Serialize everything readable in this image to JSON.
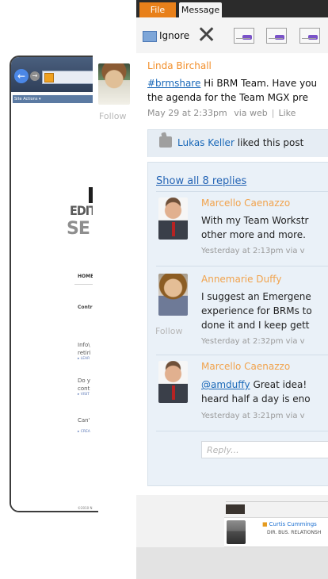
{
  "background_app": {
    "tabs": [
      "File",
      "Message"
    ],
    "toolbar": {
      "ignore_label": "Ignore"
    },
    "feed_row": {
      "name": "Curtis Cummings",
      "title": "DIR. BUS. RELATIONSH"
    }
  },
  "background_browser": {
    "site_actions": "Site Actions ▾",
    "logo_line_1": "EDIT",
    "logo_line_2": "SE",
    "home_link": "HOME",
    "section_title": "Contr",
    "items": [
      {
        "text": "Info\\ retiri",
        "link": "▸ LEAR"
      },
      {
        "text": "Do y cont",
        "link": "▸ VISIT"
      },
      {
        "text": "Can'",
        "link": "▸ CREA"
      }
    ],
    "footer": "©2010 N"
  },
  "post": {
    "author": "Linda Birchall",
    "hashtag": "#brmshare",
    "message_line1_rest": " Hi BRM Team. Have you",
    "message_line2": "the agenda for the Team MGX pre",
    "date": "May 29 at 2:33pm",
    "via": "via web",
    "like_action": "Like",
    "follow_label": "Follow"
  },
  "likes": {
    "name": "Lukas Keller",
    "suffix": " liked this post"
  },
  "replies": {
    "show_all_label": "Show all 8 replies",
    "items": [
      {
        "author": "Marcello Caenazzo",
        "line1": "With my Team Workstr",
        "line2": "other more and more.",
        "meta": "Yesterday at 2:13pm  via v"
      },
      {
        "author": "Annemarie Duffy",
        "line1": "I suggest an Emergene",
        "line2": "experience for BRMs to",
        "line3": "done it and I keep gett",
        "meta": "Yesterday at 2:32pm  via v",
        "follow_label": "Follow"
      },
      {
        "author": "Marcello Caenazzo",
        "mention": "@amduffy",
        "line1_rest": " Great idea!",
        "line2": "heard half a day is eno",
        "meta": "Yesterday at 3:21pm  via v"
      }
    ],
    "reply_placeholder": "Reply..."
  }
}
